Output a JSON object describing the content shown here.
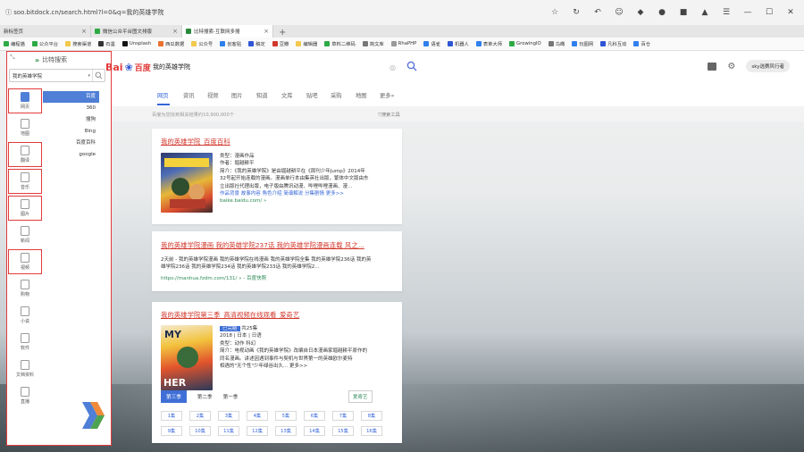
{
  "browser": {
    "url": "soo.bitdock.cn/search.html?l=0&q=我的英雄学院",
    "tabs": [
      {
        "label": "新标签页",
        "color": "#bbbbbb",
        "active": false
      },
      {
        "label": "微信公众平台图文排版",
        "color": "#2eaa45",
        "active": false
      },
      {
        "label": "比特搜索-互联网多搜",
        "color": "#2a8a3c",
        "active": true
      }
    ],
    "new_tab_symbol": "+",
    "controls": {
      "minimize": "—",
      "maximize": "☐",
      "close": "✕",
      "menu": "☰"
    },
    "bookmarks": [
      {
        "label": "编程猫",
        "color": "#2eaa45"
      },
      {
        "label": "公众平台",
        "color": "#2eaa45"
      },
      {
        "label": "搜索渠道",
        "color": "#f2c94c"
      },
      {
        "label": "石墨",
        "color": "#333333"
      },
      {
        "label": "Unsplash",
        "color": "#111111"
      },
      {
        "label": "西瓜数据",
        "color": "#e9712f"
      },
      {
        "label": "公众号",
        "color": "#f2c94c"
      },
      {
        "label": "创客贴",
        "color": "#2f80ed"
      },
      {
        "label": "稿定",
        "color": "#2f55d4"
      },
      {
        "label": "豆瓣",
        "color": "#d1372c"
      },
      {
        "label": "编辑器",
        "color": "#f2c94c"
      },
      {
        "label": "草料二维码",
        "color": "#2eaa45"
      },
      {
        "label": "简文库",
        "color": "#777777"
      },
      {
        "label": "RhaPHP",
        "color": "#999999"
      },
      {
        "label": "语雀",
        "color": "#2f80ed"
      },
      {
        "label": "机器人",
        "color": "#2f55d4"
      },
      {
        "label": "表单大师",
        "color": "#2f80ed"
      },
      {
        "label": "GrowingIO",
        "color": "#2eaa45"
      },
      {
        "label": "鸟瞰",
        "color": "#777777"
      },
      {
        "label": "玩图网",
        "color": "#2f80ed"
      },
      {
        "label": "凡科互动",
        "color": "#2f55d4"
      },
      {
        "label": "百仓",
        "color": "#2f80ed"
      }
    ]
  },
  "panel": {
    "title": "比特搜索",
    "query": "我的英雄学院",
    "categories": [
      {
        "label": "网页",
        "icon": "web-icon",
        "selected": true,
        "boxed": true
      },
      {
        "label": "地图",
        "icon": "map-pin-icon",
        "selected": false,
        "boxed": false
      },
      {
        "label": "翻译",
        "icon": "translate-icon",
        "selected": false,
        "boxed": true
      },
      {
        "label": "音乐",
        "icon": "music-icon",
        "selected": false,
        "boxed": true
      },
      {
        "label": "图片",
        "icon": "image-icon",
        "selected": false,
        "boxed": true
      },
      {
        "label": "新闻",
        "icon": "news-icon",
        "selected": false,
        "boxed": false
      },
      {
        "label": "视频",
        "icon": "video-icon",
        "selected": false,
        "boxed": true
      },
      {
        "label": "购物",
        "icon": "shopping-icon",
        "selected": false,
        "boxed": false
      },
      {
        "label": "小说",
        "icon": "book-icon",
        "selected": false,
        "boxed": false
      },
      {
        "label": "软件",
        "icon": "software-icon",
        "selected": false,
        "boxed": false
      },
      {
        "label": "文档资料",
        "icon": "document-icon",
        "selected": false,
        "boxed": false
      },
      {
        "label": "直播",
        "icon": "live-icon",
        "selected": false,
        "boxed": false
      }
    ],
    "engines": [
      {
        "label": "百度",
        "selected": true
      },
      {
        "label": "360",
        "selected": false
      },
      {
        "label": "搜狗",
        "selected": false
      },
      {
        "label": "Bing",
        "selected": false
      },
      {
        "label": "百度百科",
        "selected": false
      },
      {
        "label": "google",
        "selected": false
      }
    ]
  },
  "baidu": {
    "logo_text": "Bai",
    "logo_cn": "百度",
    "query": "我的英雄学院",
    "user": "sky选赛风行者",
    "nav": [
      "网页",
      "资讯",
      "视频",
      "图片",
      "知道",
      "文库",
      "贴吧",
      "采购",
      "地图",
      "更多»"
    ],
    "result_count": "百度为您找到相关结果约10,900,000个",
    "tools": "▽搜索工具"
  },
  "results": [
    {
      "title": "我的英雄学院_百度百科",
      "type": "类型：漫画作品",
      "author": "作者：堀越耕平",
      "intro1": "简介：《我的英雄学院》是由堀越耕平在《周刊少年Jump》2014年",
      "intro2": "32号起开始连载的漫画。漫画单行本由集英社出版，繁体中文版由东",
      "intro3": "立出版社代理出版，电子版由腾讯动漫、哔哩哔哩漫画、漫...",
      "links": "作品背景 故事内容 角色介绍 简谱解说 分集剧情 更多>>",
      "url": "baike.baidu.com/ »"
    },
    {
      "title": "我的英雄学院漫画 我的英雄学院237话 我的英雄学院漫画连载 风之...",
      "line1": "2天前 - 我的英雄学院漫画 我的英雄学院在线漫画 我的英雄学院全集 我的英雄学院236话 我的英",
      "line2": "雄学院236话 我的英雄学院234话 我的英雄学院233话 我的英雄学院2...",
      "url": "https://manhua.fzdm.com/131/ » - 百度快照"
    },
    {
      "title": "我的英雄学院第三季_高清视频在线观看_爱奇艺",
      "badge": "已完结",
      "episodes_total": "共25集",
      "year": "2018 | 日本 | 日语",
      "genre": "类型：动作 科幻",
      "intro1": "简介：电视动画《我的英雄学院》改编自日本漫画家堀越耕平原作的",
      "intro2": "同名漫画。讲述因遇到事件与契机与世界第一的英雄欧尔麦特",
      "intro3": "相遇的\"无个性\"少年绿谷出久... 更多>>",
      "seasons": [
        "第三季",
        "第二季",
        "第一季"
      ],
      "source": "爱奇艺",
      "ep_row1": [
        "1集",
        "2集",
        "3集",
        "4集",
        "5集",
        "6集",
        "7集",
        "8集"
      ],
      "ep_row2": [
        "9集",
        "10集",
        "11集",
        "12集",
        "13集",
        "14集",
        "15集",
        "16集"
      ]
    }
  ],
  "colors": {
    "accent": "#3665d8",
    "title_red": "#d1372c",
    "annotation_red": "#e23b3b",
    "panel_green": "#2a8a3c"
  }
}
